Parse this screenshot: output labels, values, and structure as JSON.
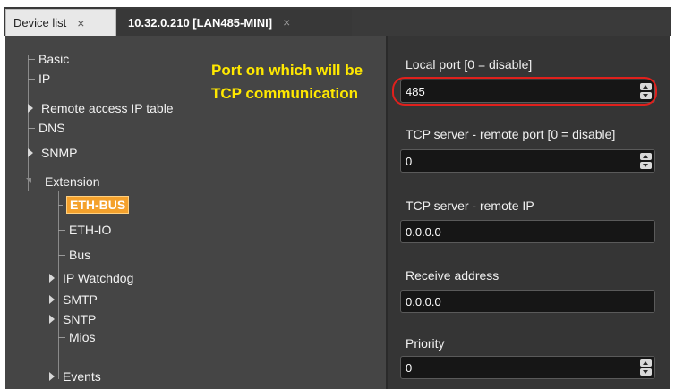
{
  "tabs": [
    {
      "label": "Device list",
      "close": "×"
    },
    {
      "label": "10.32.0.210 [LAN485-MINI]",
      "close": "×"
    }
  ],
  "tree": {
    "basic": "Basic",
    "ip": "IP",
    "remote_access": "Remote access IP table",
    "dns": "DNS",
    "snmp": "SNMP",
    "extension": "Extension",
    "eth_bus": "ETH-BUS",
    "eth_io": "ETH-IO",
    "bus": "Bus",
    "ip_watchdog": "IP Watchdog",
    "smtp": "SMTP",
    "sntp": "SNTP",
    "mios": "Mios",
    "events": "Events"
  },
  "annotation": "Port on which will be TCP communication",
  "fields": {
    "local_port_label": "Local port [0 = disable]",
    "local_port_value": "485",
    "tcp_remote_port_label": "TCP server - remote port [0 = disable]",
    "tcp_remote_port_value": "0",
    "tcp_remote_ip_label": "TCP server - remote IP",
    "tcp_remote_ip_value": "0.0.0.0",
    "receive_address_label": "Receive address",
    "receive_address_value": "0.0.0.0",
    "priority_label": "Priority",
    "priority_value": "0"
  },
  "colors": {
    "selected": "#f4a12c",
    "annotation": "#ffe800",
    "highlight": "#e0201c"
  },
  "icons": {
    "expand": "caret-right-icon",
    "collapse": "caret-down-icon",
    "spinner": "spinner-arrows-icon",
    "close": "close-icon"
  }
}
